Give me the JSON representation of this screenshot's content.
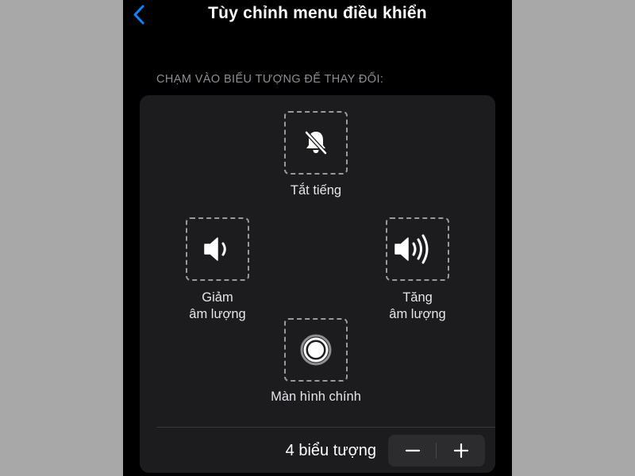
{
  "nav": {
    "title": "Tùy chỉnh menu điều khiển",
    "back_icon": "chevron-left-icon"
  },
  "section_header": "CHẠM VÀO BIỂU TƯỢNG ĐỂ THAY ĐỔI:",
  "tiles": {
    "mute": {
      "line1": "Tắt tiếng",
      "icon": "bell-slash-icon"
    },
    "volume_down": {
      "line1": "Giảm",
      "line2": "âm lượng",
      "icon": "speaker-low-icon"
    },
    "volume_up": {
      "line1": "Tăng",
      "line2": "âm lượng",
      "icon": "speaker-high-icon"
    },
    "home": {
      "line1": "Màn hình chính",
      "icon": "home-button-icon"
    }
  },
  "footer": {
    "count_label": "4 biểu tượng",
    "minus_icon": "minus-icon",
    "plus_icon": "plus-icon"
  },
  "colors": {
    "accent": "#0a84ff",
    "background": "#000000",
    "card": "#1c1c1e"
  }
}
